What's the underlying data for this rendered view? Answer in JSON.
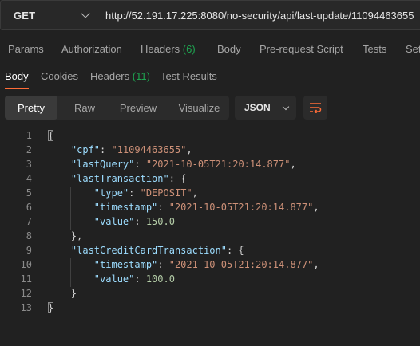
{
  "request": {
    "method": "GET",
    "url": "http://52.191.17.225:8080/no-security/api/last-update/11094463655"
  },
  "request_tabs": {
    "params": "Params",
    "authorization": "Authorization",
    "headers": "Headers",
    "headers_count": "(6)",
    "body": "Body",
    "prerequest": "Pre-request Script",
    "tests": "Tests",
    "settings": "Set"
  },
  "response_tabs": {
    "body": "Body",
    "cookies": "Cookies",
    "headers": "Headers",
    "headers_count": "(11)",
    "test_results": "Test Results"
  },
  "view": {
    "pretty": "Pretty",
    "raw": "Raw",
    "preview": "Preview",
    "visualize": "Visualize",
    "format": "JSON"
  },
  "colors": {
    "accent": "#ff6c37",
    "count_green": "#1ea450",
    "json_key": "#9cdcfe",
    "json_string": "#ce9178",
    "json_number": "#b5cea8"
  },
  "code": {
    "line_numbers": [
      "1",
      "2",
      "3",
      "4",
      "5",
      "6",
      "7",
      "8",
      "9",
      "10",
      "11",
      "12",
      "13"
    ],
    "open_brace": "{",
    "cpf_key": "\"cpf\"",
    "cpf_value": "\"11094463655\"",
    "lastQuery_key": "\"lastQuery\"",
    "lastQuery_value": "\"2021-10-05T21:20:14.877\"",
    "lastTransaction_key": "\"lastTransaction\"",
    "type_key": "\"type\"",
    "type_value": "\"DEPOSIT\"",
    "timestamp_key": "\"timestamp\"",
    "timestamp_value": "\"2021-10-05T21:20:14.877\"",
    "value_key": "\"value\"",
    "value_value": "150.0",
    "close_obj": "},",
    "lastCreditCard_key": "\"lastCreditCardTransaction\"",
    "cc_timestamp_key": "\"timestamp\"",
    "cc_timestamp_value": "\"2021-10-05T21:20:14.877\"",
    "cc_value_key": "\"value\"",
    "cc_value_value": "100.0",
    "inner_close": "}",
    "close_brace": "}"
  }
}
